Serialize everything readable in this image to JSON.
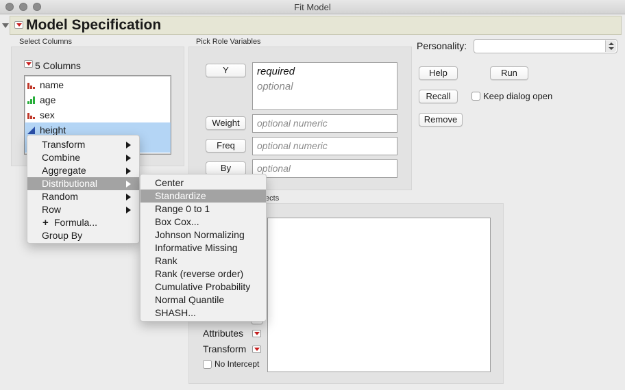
{
  "window": {
    "title": "Fit Model"
  },
  "header": {
    "title": "Model Specification"
  },
  "select_columns": {
    "label": "Select Columns",
    "count_label": "5 Columns",
    "columns": [
      {
        "name": "name",
        "icon": "nominal-bars-icon",
        "color": "#c0392b"
      },
      {
        "name": "age",
        "icon": "ordinal-bars-icon",
        "color": "#27ae3a"
      },
      {
        "name": "sex",
        "icon": "nominal-bars-icon",
        "color": "#c0392b"
      },
      {
        "name": "height",
        "icon": "continuous-triangle-icon",
        "color": "#2a4fa8"
      }
    ]
  },
  "pick_role": {
    "label": "Pick Role Variables",
    "y_button": "Y",
    "y_required": "required",
    "y_optional": "optional",
    "weight_button": "Weight",
    "weight_placeholder": "optional numeric",
    "freq_button": "Freq",
    "freq_placeholder": "optional numeric",
    "by_button": "By",
    "by_placeholder": "optional"
  },
  "personality": {
    "label": "Personality:",
    "value": ""
  },
  "actions": {
    "help": "Help",
    "run": "Run",
    "recall": "Recall",
    "keep_open": "Keep dialog open",
    "remove": "Remove"
  },
  "effects": {
    "label_fragment": "fects",
    "attributes": "Attributes",
    "transform": "Transform",
    "no_intercept": "No Intercept"
  },
  "context_menu": {
    "items": [
      {
        "label": "Transform",
        "submenu": true
      },
      {
        "label": "Combine",
        "submenu": true
      },
      {
        "label": "Aggregate",
        "submenu": true
      },
      {
        "label": "Distributional",
        "submenu": true,
        "highlighted": true
      },
      {
        "label": "Random",
        "submenu": true
      },
      {
        "label": "Row",
        "submenu": true
      },
      {
        "label": "Formula...",
        "icon": "plus-icon"
      },
      {
        "label": "Group By"
      }
    ]
  },
  "submenu": {
    "items": [
      {
        "label": "Center"
      },
      {
        "label": "Standardize",
        "highlighted": true
      },
      {
        "label": "Range 0 to 1"
      },
      {
        "label": "Box Cox..."
      },
      {
        "label": "Johnson Normalizing"
      },
      {
        "label": "Informative Missing"
      },
      {
        "label": "Rank"
      },
      {
        "label": "Rank (reverse order)"
      },
      {
        "label": "Cumulative Probability"
      },
      {
        "label": "Normal Quantile"
      },
      {
        "label": "SHASH..."
      }
    ]
  }
}
